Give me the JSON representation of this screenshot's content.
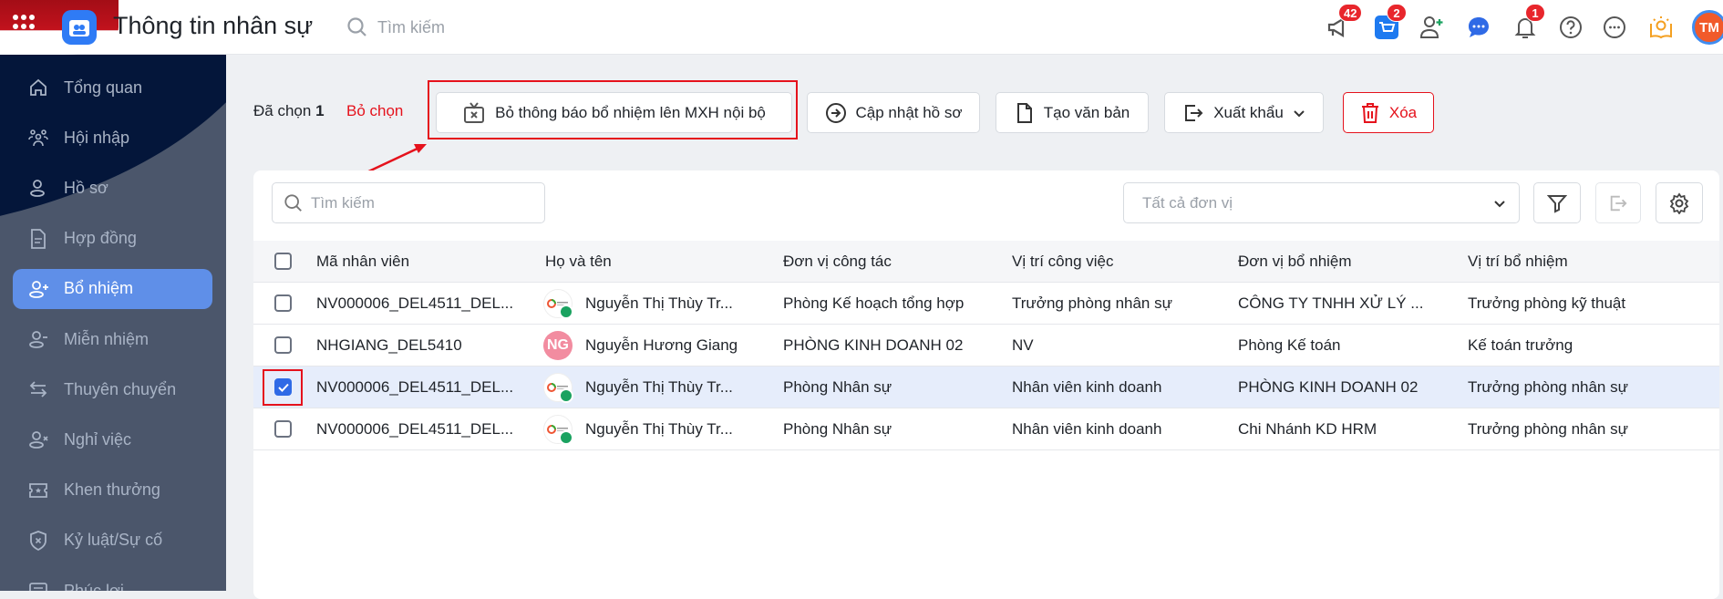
{
  "header": {
    "title": "Thông tin nhân sự",
    "search_placeholder": "Tìm kiếm",
    "badges": {
      "announcements": "42",
      "cart": "2",
      "notifications": "1"
    },
    "avatar_initials": "TM"
  },
  "sidebar": {
    "items": [
      {
        "label": "Tổng quan",
        "icon": "home-icon"
      },
      {
        "label": "Hội nhập",
        "icon": "users-icon"
      },
      {
        "label": "Hồ sơ",
        "icon": "user-icon"
      },
      {
        "label": "Hợp đồng",
        "icon": "document-icon"
      },
      {
        "label": "Bổ nhiệm",
        "icon": "user-plus-icon",
        "active": true
      },
      {
        "label": "Miễn nhiệm",
        "icon": "user-minus-icon"
      },
      {
        "label": "Thuyên chuyển",
        "icon": "transfer-icon"
      },
      {
        "label": "Nghỉ việc",
        "icon": "user-x-icon"
      },
      {
        "label": "Khen thưởng",
        "icon": "ticket-star-icon"
      },
      {
        "label": "Kỷ luật/Sự cố",
        "icon": "shield-x-icon"
      },
      {
        "label": "Phúc lợi",
        "icon": "list-icon"
      }
    ]
  },
  "toolbar": {
    "selected_label": "Đã chọn",
    "selected_count": "1",
    "deselect": "Bỏ chọn",
    "unpublish": "Bỏ thông báo bổ nhiệm lên MXH nội bộ",
    "update": "Cập nhật hồ sơ",
    "create_doc": "Tạo văn bản",
    "export": "Xuất khẩu",
    "delete": "Xóa"
  },
  "filters": {
    "search_placeholder": "Tìm kiếm",
    "unit_placeholder": "Tất cả đơn vị"
  },
  "table": {
    "columns": [
      "Mã nhân viên",
      "Họ và tên",
      "Đơn vị công tác",
      "Vị trí công việc",
      "Đơn vị bổ nhiệm",
      "Vị trí bổ nhiệm"
    ],
    "rows": [
      {
        "checked": false,
        "code": "NV000006_DEL4511_DEL...",
        "name": "Nguyễn Thị Thùy Tr...",
        "unit": "Phòng Kế hoạch tổng hợp",
        "position": "Trưởng phòng nhân sự",
        "appoint_unit": "CÔNG TY TNHH XỬ LÝ ...",
        "appoint_position": "Trưởng phòng kỹ thuật"
      },
      {
        "checked": false,
        "code": "NHGIANG_DEL5410",
        "name": "Nguyễn Hương Giang",
        "initials": "NG",
        "unit": "PHÒNG KINH DOANH 02",
        "position": "NV",
        "appoint_unit": "Phòng Kế toán",
        "appoint_position": "Kế toán trưởng"
      },
      {
        "checked": true,
        "code": "NV000006_DEL4511_DEL...",
        "name": "Nguyễn Thị Thùy Tr...",
        "unit": "Phòng Nhân sự",
        "position": "Nhân viên kinh doanh",
        "appoint_unit": "PHÒNG KINH DOANH 02",
        "appoint_position": "Trưởng phòng nhân sự"
      },
      {
        "checked": false,
        "code": "NV000006_DEL4511_DEL...",
        "name": "Nguyễn Thị Thùy Tr...",
        "unit": "Phòng Nhân sự",
        "position": "Nhân viên kinh doanh",
        "appoint_unit": "Chi Nhánh KD HRM",
        "appoint_position": "Trưởng phòng nhân sự"
      }
    ]
  },
  "colors": {
    "accent": "#2f6ae6",
    "danger": "#e5121c",
    "sidebar": "#4b566b",
    "sidebar_top": "#04163a",
    "selected_row": "#e6edfb"
  }
}
